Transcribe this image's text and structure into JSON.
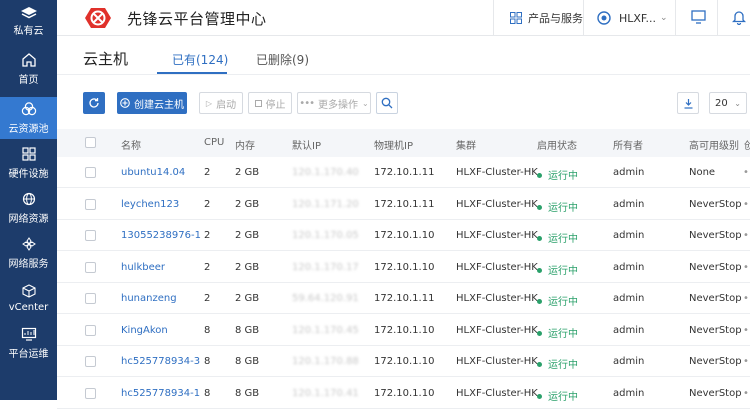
{
  "sidebar": {
    "top_label": "私有云",
    "items": [
      {
        "label": "首页",
        "icon": "home-icon"
      },
      {
        "label": "云资源池",
        "icon": "cloud-pool-icon",
        "active": true
      },
      {
        "label": "硬件设施",
        "icon": "hardware-icon"
      },
      {
        "label": "网络资源",
        "icon": "network-resource-icon"
      },
      {
        "label": "网络服务",
        "icon": "network-service-icon"
      },
      {
        "label": "vCenter",
        "icon": "vcenter-icon"
      },
      {
        "label": "平台运维",
        "icon": "platform-ops-icon"
      }
    ]
  },
  "header": {
    "brand": "先锋云平台管理中心",
    "products": "产品与服务",
    "user": "HLXF...",
    "accent": "#2f6fc2",
    "logo_color": "#e0312b"
  },
  "page": {
    "title": "云主机",
    "tabs": [
      {
        "label": "已有(124)",
        "active": true
      },
      {
        "label": "已删除(9)",
        "active": false
      }
    ]
  },
  "toolbar": {
    "create": "创建云主机",
    "start": "启动",
    "stop": "停止",
    "more": "更多操作",
    "page_size": "20"
  },
  "table": {
    "columns": [
      "名称",
      "CPU",
      "内存",
      "默认IP",
      "物理机IP",
      "集群",
      "启用状态",
      "所有者",
      "高可用级别",
      "创"
    ],
    "rows": [
      {
        "name": "ubuntu14.04",
        "cpu": "2",
        "mem": "2 GB",
        "ip": "120.1.170.40",
        "host": "172.10.1.11",
        "cluster": "HLXF-Cluster-HK",
        "status": "运行中",
        "owner": "admin",
        "ha": "None"
      },
      {
        "name": "leychen123",
        "cpu": "2",
        "mem": "2 GB",
        "ip": "120.1.171.20",
        "host": "172.10.1.11",
        "cluster": "HLXF-Cluster-HK",
        "status": "运行中",
        "owner": "admin",
        "ha": "NeverStop"
      },
      {
        "name": "13055238976-1",
        "cpu": "2",
        "mem": "2 GB",
        "ip": "120.1.170.05",
        "host": "172.10.1.10",
        "cluster": "HLXF-Cluster-HK",
        "status": "运行中",
        "owner": "admin",
        "ha": "NeverStop"
      },
      {
        "name": "hulkbeer",
        "cpu": "2",
        "mem": "2 GB",
        "ip": "120.1.170.17",
        "host": "172.10.1.10",
        "cluster": "HLXF-Cluster-HK",
        "status": "运行中",
        "owner": "admin",
        "ha": "NeverStop"
      },
      {
        "name": "hunanzeng",
        "cpu": "2",
        "mem": "2 GB",
        "ip": "59.64.120.91",
        "host": "172.10.1.11",
        "cluster": "HLXF-Cluster-HK",
        "status": "运行中",
        "owner": "admin",
        "ha": "NeverStop"
      },
      {
        "name": "KingAkon",
        "cpu": "8",
        "mem": "8 GB",
        "ip": "120.1.170.45",
        "host": "172.10.1.10",
        "cluster": "HLXF-Cluster-HK",
        "status": "运行中",
        "owner": "admin",
        "ha": "NeverStop"
      },
      {
        "name": "hc525778934-3",
        "cpu": "8",
        "mem": "8 GB",
        "ip": "120.1.170.88",
        "host": "172.10.1.10",
        "cluster": "HLXF-Cluster-HK",
        "status": "运行中",
        "owner": "admin",
        "ha": "NeverStop"
      },
      {
        "name": "hc525778934-1",
        "cpu": "8",
        "mem": "8 GB",
        "ip": "120.1.170.41",
        "host": "172.10.1.10",
        "cluster": "HLXF-Cluster-HK",
        "status": "运行中",
        "owner": "admin",
        "ha": "NeverStop"
      }
    ]
  }
}
